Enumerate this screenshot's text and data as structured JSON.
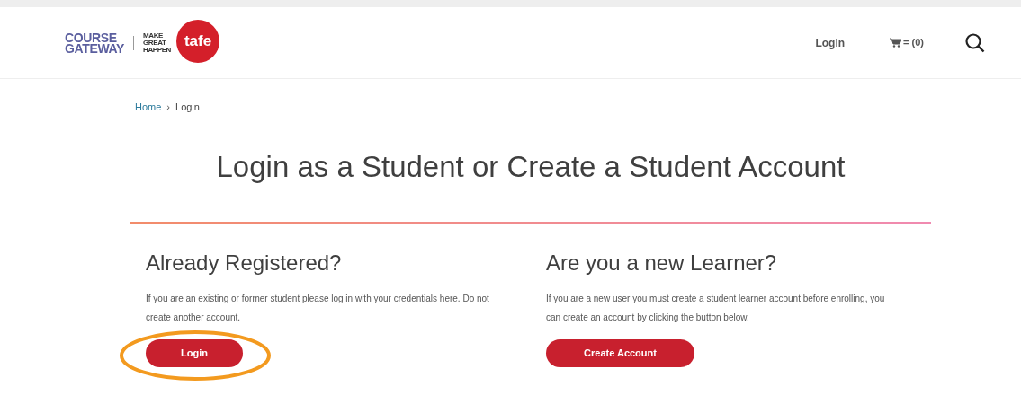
{
  "header": {
    "logo": {
      "course": "COURSE",
      "gateway": "GATEWAY",
      "slogan": [
        "MAKE",
        "GREAT",
        "HAPPEN"
      ],
      "tafe": "tafe"
    },
    "nav": [
      {
        "kind": "link",
        "label": "Login"
      },
      {
        "kind": "cart",
        "label": "= (0)"
      },
      {
        "kind": "search"
      }
    ]
  },
  "breadcrumb": [
    {
      "label": "Home",
      "selected": false
    },
    {
      "label": "Login",
      "selected": true
    }
  ],
  "breadcrumb_separator": "›",
  "title": "Login as a Student or Create a Student Account",
  "sections": [
    {
      "heading": "Already Registered?",
      "text": "If you are an existing or former student please log in with your credentials here. Do not create another account.",
      "button": "Login",
      "highlighted": true
    },
    {
      "heading": "Are you a new Learner?",
      "text": "If you are a new user you must create a student learner account before enrolling, you can create an account by clicking the button below.",
      "button": "Create Account",
      "highlighted": false
    }
  ]
}
